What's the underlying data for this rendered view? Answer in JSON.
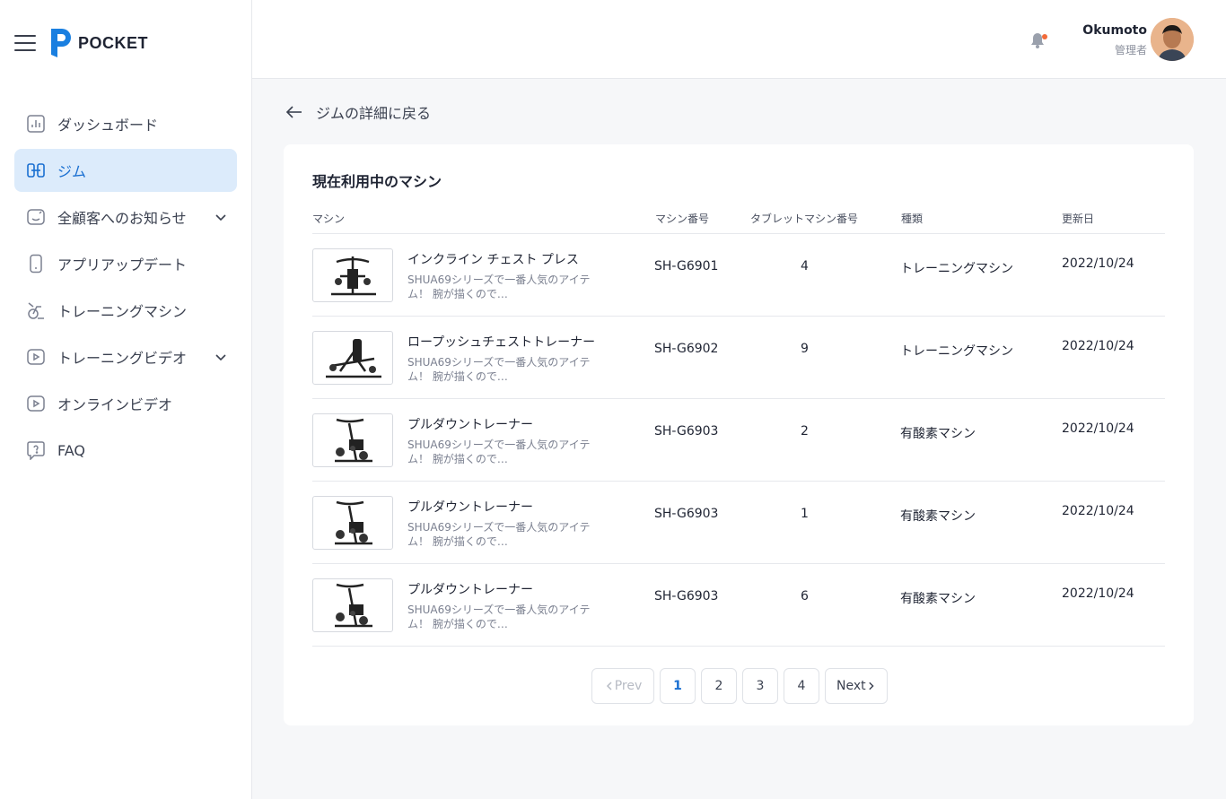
{
  "brand": {
    "name": "POCKET"
  },
  "sidebar": {
    "items": [
      {
        "label": "ダッシュボード",
        "icon": "bar-chart-icon"
      },
      {
        "label": "ジム",
        "icon": "gym-icon",
        "active": true
      },
      {
        "label": "全顧客へのお知らせ",
        "icon": "announcement-icon",
        "expandable": true
      },
      {
        "label": "アプリアップデート",
        "icon": "phone-icon"
      },
      {
        "label": "トレーニングマシン",
        "icon": "exercise-bike-icon"
      },
      {
        "label": "トレーニングビデオ",
        "icon": "video-icon",
        "expandable": true
      },
      {
        "label": "オンラインビデオ",
        "icon": "video-icon"
      },
      {
        "label": "FAQ",
        "icon": "question-bubble-icon"
      }
    ]
  },
  "header": {
    "user_name": "Okumoto",
    "user_role": "管理者",
    "notification_dot_color": "#f26b3a"
  },
  "back_link": "ジムの詳細に戻る",
  "card": {
    "title": "現在利用中のマシン",
    "columns": [
      "マシン",
      "マシン番号",
      "タブレットマシン番号",
      "種類",
      "更新日"
    ]
  },
  "rows": [
    {
      "name": "インクライン チェスト プレス",
      "desc": "SHUA69シリーズで一番人気のアイテム！ 腕が描くので…",
      "number": "SH-G6901",
      "tablet": "4",
      "type": "トレーニングマシン",
      "date": "2022/10/24"
    },
    {
      "name": "ロープッシュチェストトレーナー",
      "desc": "SHUA69シリーズで一番人気のアイテム！ 腕が描くので…",
      "number": "SH-G6902",
      "tablet": "9",
      "type": "トレーニングマシン",
      "date": "2022/10/24"
    },
    {
      "name": "プルダウントレーナー",
      "desc": "SHUA69シリーズで一番人気のアイテム！ 腕が描くので…",
      "number": "SH-G6903",
      "tablet": "2",
      "type": "有酸素マシン",
      "date": "2022/10/24"
    },
    {
      "name": "プルダウントレーナー",
      "desc": "SHUA69シリーズで一番人気のアイテム！ 腕が描くので…",
      "number": "SH-G6903",
      "tablet": "1",
      "type": "有酸素マシン",
      "date": "2022/10/24"
    },
    {
      "name": "プルダウントレーナー",
      "desc": "SHUA69シリーズで一番人気のアイテム！ 腕が描くので…",
      "number": "SH-G6903",
      "tablet": "6",
      "type": "有酸素マシン",
      "date": "2022/10/24"
    }
  ],
  "pagination": {
    "prev": "Prev",
    "pages": [
      "1",
      "2",
      "3",
      "4"
    ],
    "current": "1",
    "next": "Next"
  },
  "colors": {
    "accent": "#1a6fd1",
    "active_bg": "#dcebfb",
    "logo_blue": "#1a7fe0"
  }
}
